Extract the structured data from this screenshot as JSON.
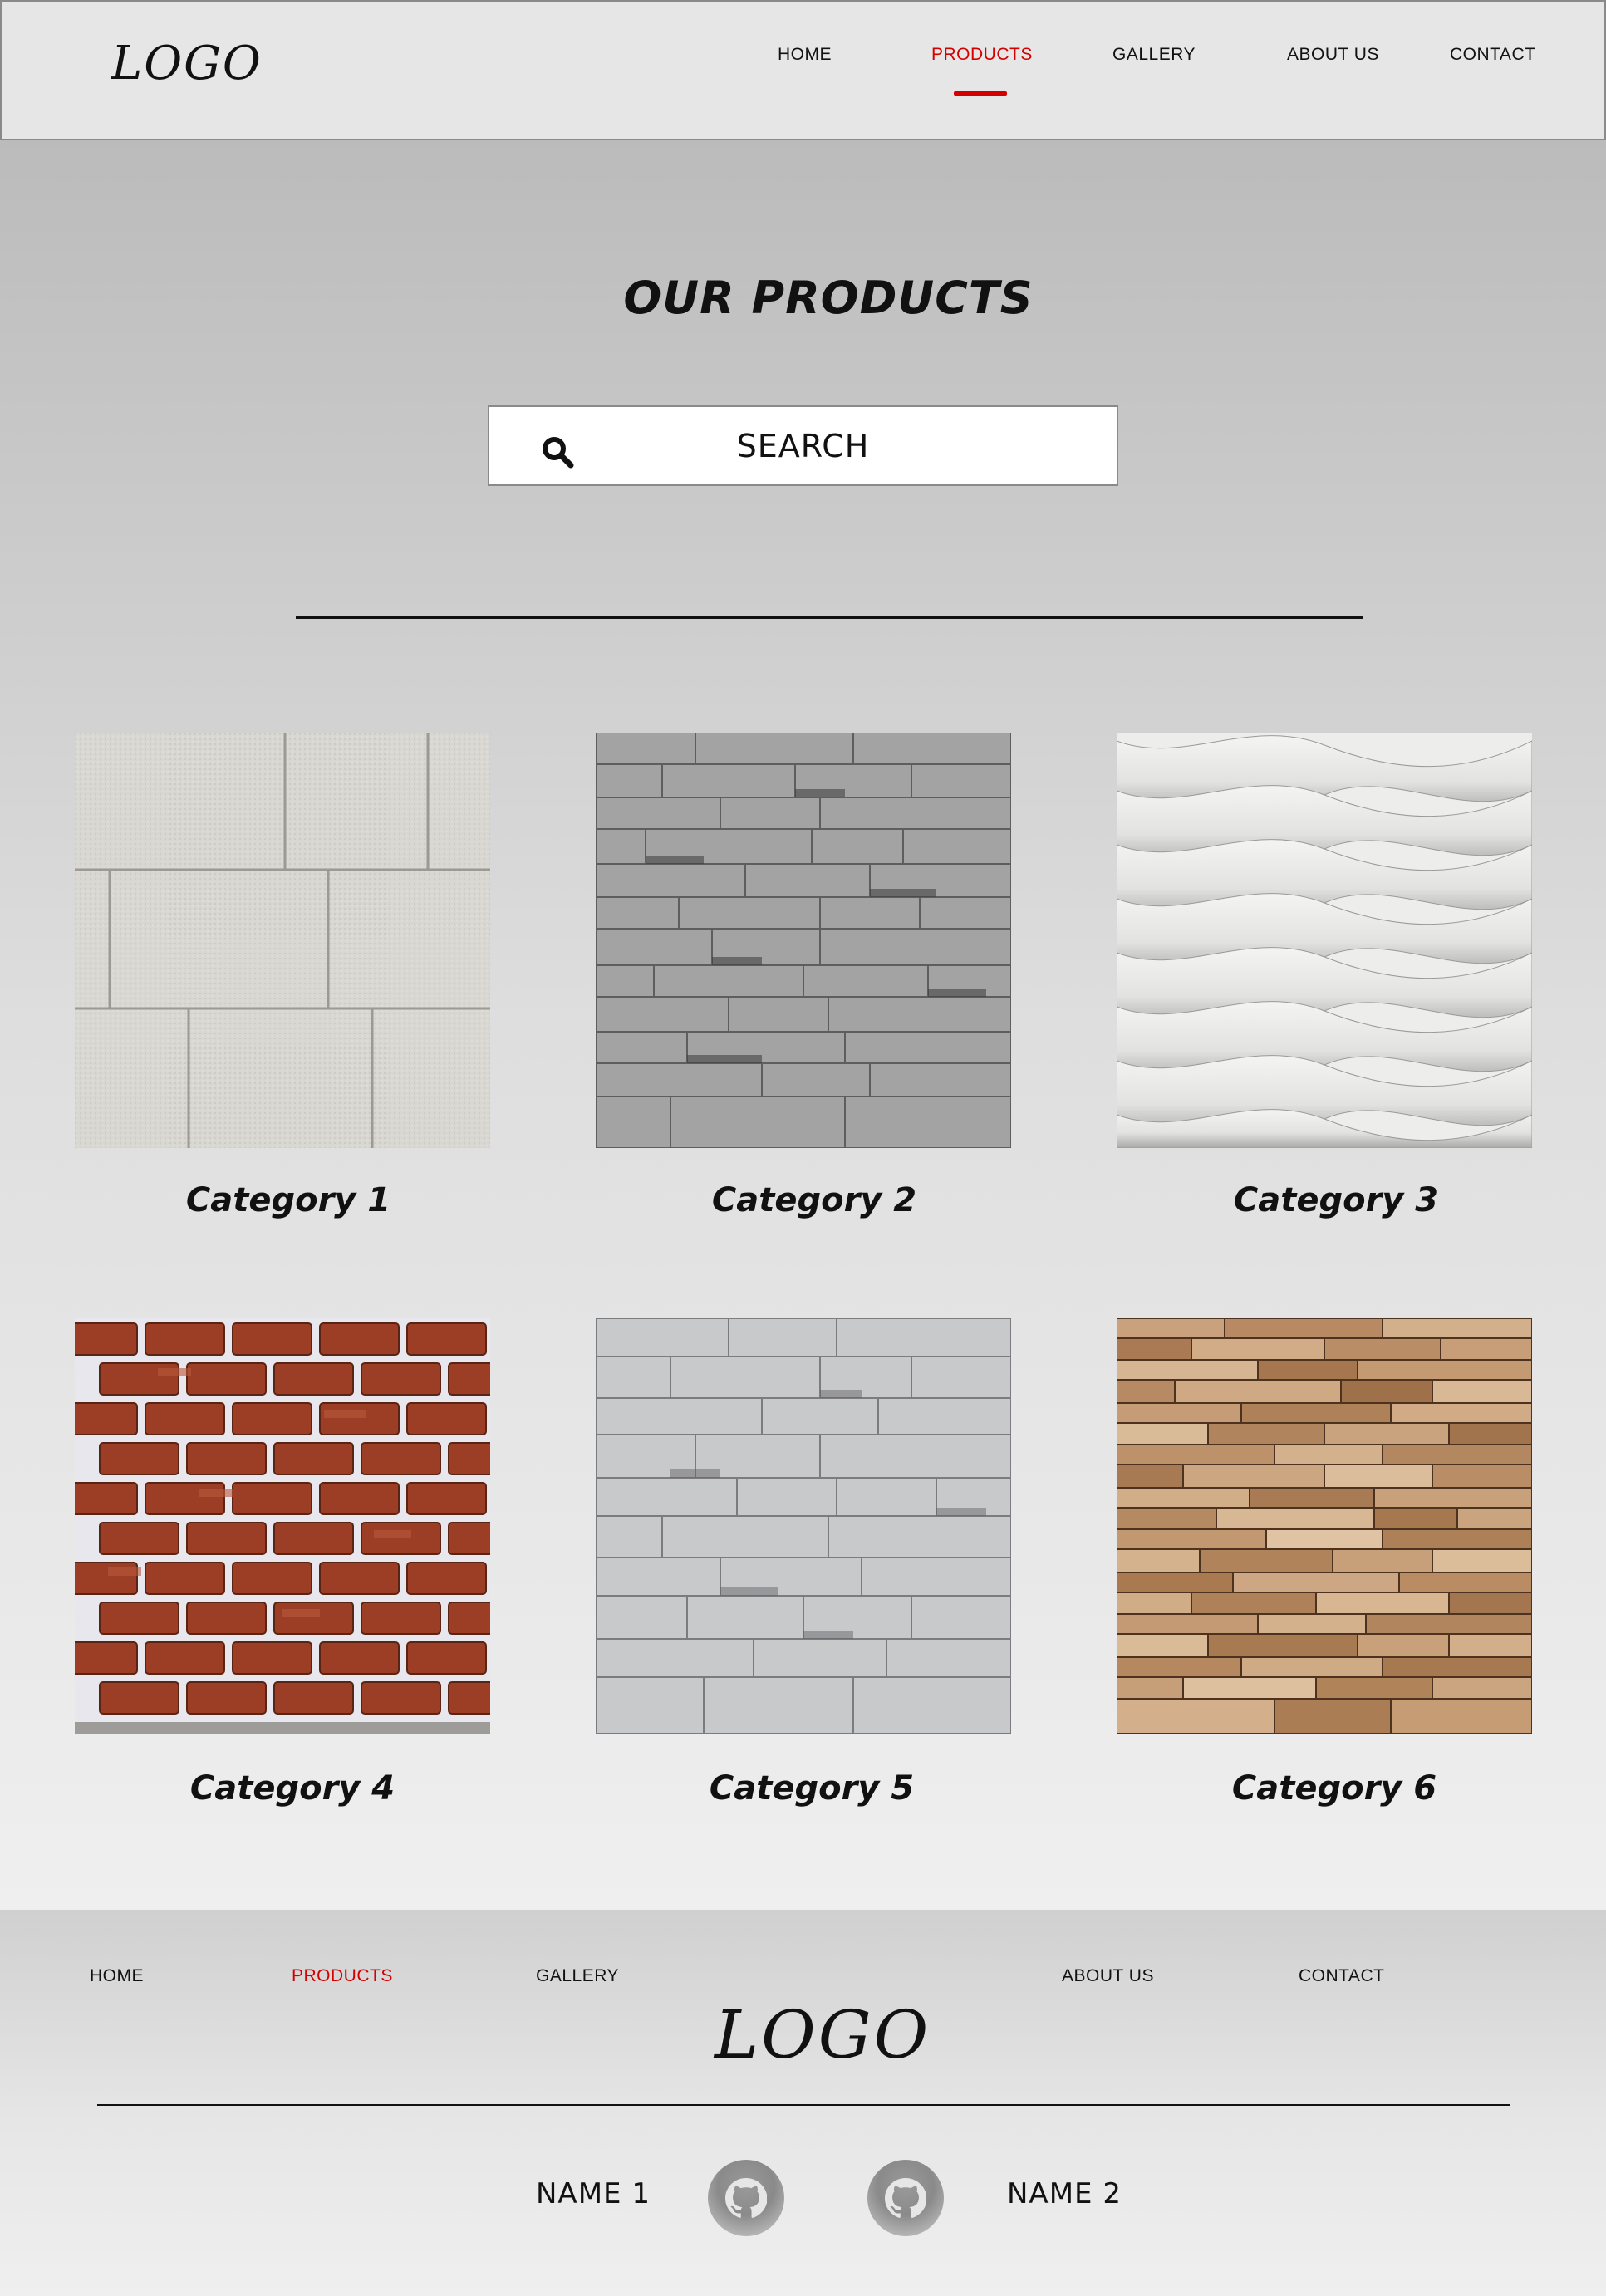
{
  "header": {
    "logo": "LOGO",
    "nav": [
      {
        "label": "HOME"
      },
      {
        "label": "PRODUCTS",
        "active": true
      },
      {
        "label": "GALLERY"
      },
      {
        "label": "ABOUT US"
      },
      {
        "label": "CONTACT"
      }
    ]
  },
  "main": {
    "title": "OUR PRODUCTS",
    "search": {
      "label": "SEARCH",
      "icon": "search-icon"
    },
    "categories": [
      {
        "label": "Category 1",
        "texture": "white-stone-blocks"
      },
      {
        "label": "Category 2",
        "texture": "gray-slate-stacked"
      },
      {
        "label": "Category 3",
        "texture": "white-wave-panel"
      },
      {
        "label": "Category 4",
        "texture": "red-brick"
      },
      {
        "label": "Category 5",
        "texture": "light-gray-slate"
      },
      {
        "label": "Category 6",
        "texture": "tan-ledgestone"
      }
    ]
  },
  "footer": {
    "nav": [
      {
        "label": "HOME"
      },
      {
        "label": "PRODUCTS",
        "active": true
      },
      {
        "label": "GALLERY"
      },
      {
        "label": "ABOUT US"
      },
      {
        "label": "CONTACT"
      }
    ],
    "logo": "LOGO",
    "names": [
      "NAME 1",
      "NAME 2"
    ],
    "icons": [
      "github-icon",
      "github-icon"
    ]
  },
  "colors": {
    "accent": "#d40000",
    "header_bg": "#e6e6e6",
    "text": "#111111"
  }
}
